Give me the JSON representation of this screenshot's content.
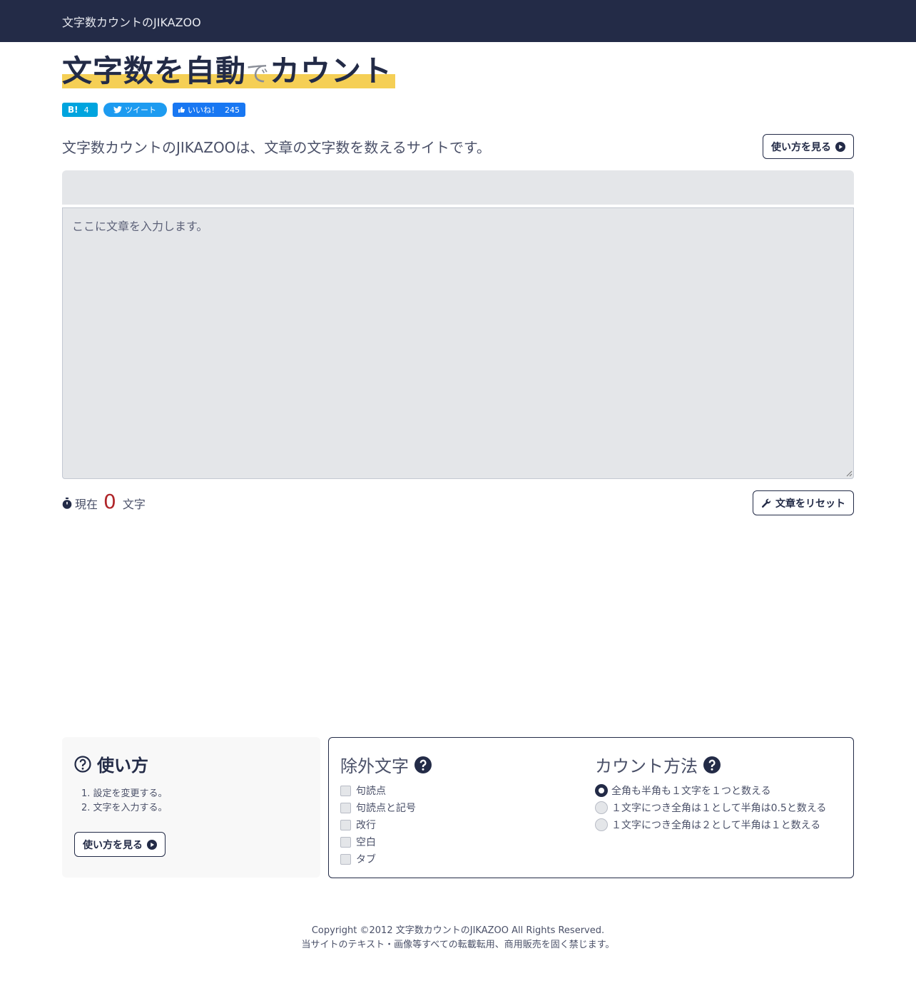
{
  "nav": {
    "brand": "文字数カウントのJIKAZOO"
  },
  "title": {
    "part1": "文字数を自動",
    "part2": "で",
    "part3": "カウント"
  },
  "share": {
    "hatena_label": "B!",
    "hatena_count": "4",
    "tweet_label": "ツイート",
    "like_label": "いいね！",
    "like_count": "245"
  },
  "intro": "文字数カウントのJIKAZOOは、文章の文字数を数えるサイトです。",
  "howto_button": "使い方を見る",
  "editor": {
    "placeholder": "ここに文章を入力します。",
    "value": ""
  },
  "counter": {
    "prefix": "現在",
    "count": "0",
    "suffix": "文字"
  },
  "reset_button": "文章をリセット",
  "help": {
    "title": "使い方",
    "steps": [
      "1. 設定を変更する。",
      "2. 文字を入力する。"
    ],
    "button": "使い方を見る"
  },
  "exclude": {
    "title": "除外文字",
    "options": [
      "句読点",
      "句読点と記号",
      "改行",
      "空白",
      "タブ"
    ],
    "checked": [
      false,
      false,
      false,
      false,
      false
    ]
  },
  "count_method": {
    "title": "カウント方法",
    "options": [
      "全角も半角も１文字を１つと数える",
      "１文字につき全角は１として半角は0.5と数える",
      "１文字につき全角は２として半角は１と数える"
    ],
    "selected_index": 0
  },
  "footer": {
    "copyright": "Copyright ©2012 文字数カウントのJIKAZOO All Rights Reserved.",
    "notice": "当サイトのテキスト・画像等すべての転載転用、商用販売を固く禁じます。"
  },
  "colors": {
    "navbar": "#232b47",
    "highlight": "#f5cf55",
    "count": "#b0262a",
    "hatena": "#00a4de",
    "twitter": "#1d9bf0",
    "facebook": "#1877f2"
  }
}
